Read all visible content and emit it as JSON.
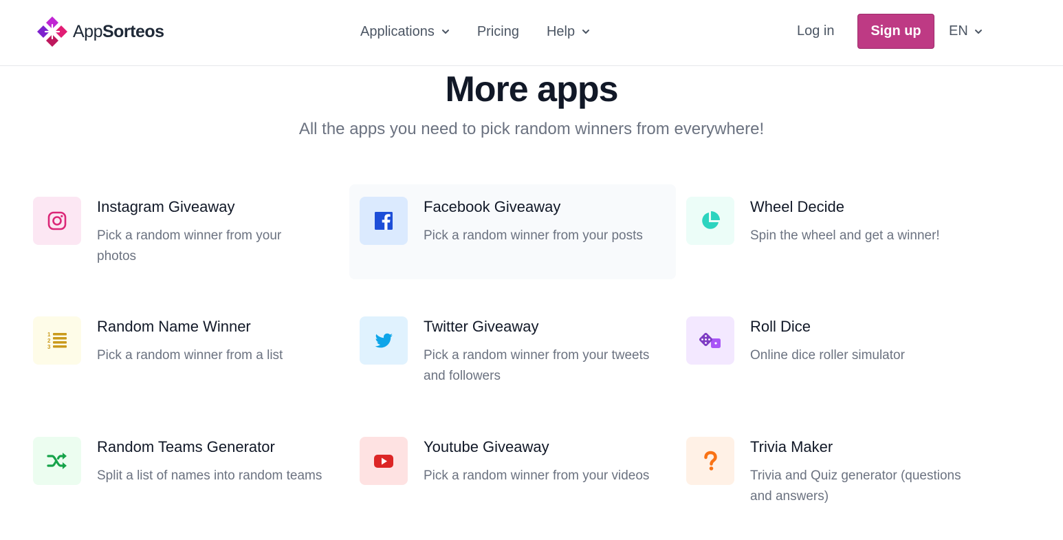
{
  "header": {
    "logo_prefix": "App",
    "logo_suffix": "Sorteos",
    "nav": [
      {
        "label": "Applications",
        "has_dropdown": true
      },
      {
        "label": "Pricing",
        "has_dropdown": false
      },
      {
        "label": "Help",
        "has_dropdown": true
      }
    ],
    "login_label": "Log in",
    "signup_label": "Sign up",
    "language": "EN"
  },
  "hero": {
    "title": "More apps",
    "subtitle": "All the apps you need to pick random winners from everywhere!"
  },
  "apps": [
    {
      "name": "Instagram Giveaway",
      "desc": "Pick a random winner from your photos",
      "icon": "instagram-icon",
      "icon_color": "#db2777",
      "icon_bg": "#fce7f3"
    },
    {
      "name": "Facebook Giveaway",
      "desc": "Pick a random winner from your posts",
      "icon": "facebook-icon",
      "icon_color": "#1d4ed8",
      "icon_bg": "#dbeafe"
    },
    {
      "name": "Wheel Decide",
      "desc": "Spin the wheel and get a winner!",
      "icon": "pie-chart-icon",
      "icon_color": "#2dd4bf",
      "icon_bg": "#ecfdf8"
    },
    {
      "name": "Random Name Winner",
      "desc": "Pick a random winner from a list",
      "icon": "numbered-list-icon",
      "icon_color": "#ca9a1b",
      "icon_bg": "#fefce8"
    },
    {
      "name": "Twitter Giveaway",
      "desc": "Pick a random winner from your tweets and followers",
      "icon": "twitter-icon",
      "icon_color": "#0ea5e9",
      "icon_bg": "#e0f2fe"
    },
    {
      "name": "Roll Dice",
      "desc": "Online dice roller simulator",
      "icon": "dice-icon",
      "icon_color": "#a855f7",
      "icon_bg": "#f3e8ff"
    },
    {
      "name": "Random Teams Generator",
      "desc": "Split a list of names into random teams",
      "icon": "shuffle-icon",
      "icon_color": "#16a34a",
      "icon_bg": "#ecfdf0"
    },
    {
      "name": "Youtube Giveaway",
      "desc": "Pick a random winner from your videos",
      "icon": "youtube-icon",
      "icon_color": "#dc2626",
      "icon_bg": "#fee2e2"
    },
    {
      "name": "Trivia Maker",
      "desc": "Trivia and Quiz generator (questions and answers)",
      "icon": "question-mark-icon",
      "icon_color": "#f97316",
      "icon_bg": "#fff1e6"
    }
  ],
  "colors": {
    "brand": "#be3a84",
    "hover_card": "#f8fafc"
  }
}
